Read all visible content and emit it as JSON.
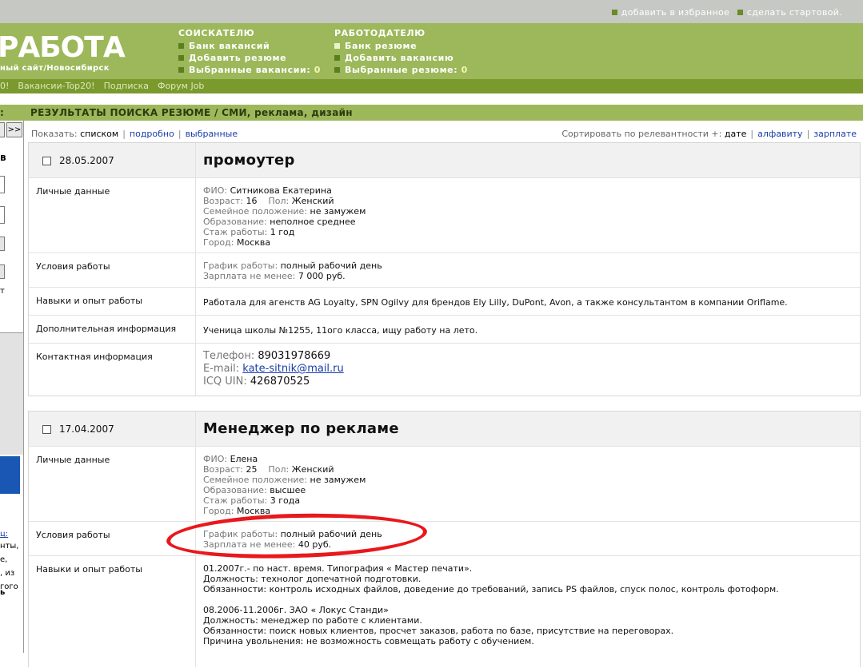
{
  "top_links": {
    "favorites": "добавить в избранное",
    "start_page": "сделать стартовой."
  },
  "logo": {
    "text": "РАБОТА",
    "tagline": "ный сайт/Новосибирск"
  },
  "applicant_menu": {
    "heading": "СОИСКАТЕЛЮ",
    "items": [
      "Банк вакансий",
      "Добавить резюме",
      "Выбранные вакансии:"
    ],
    "count": "0"
  },
  "employer_menu": {
    "heading": "РАБОТОДАТЕЛЮ",
    "items": [
      "Банк резюме",
      "Добавить вакансию",
      "Выбранные резюме:"
    ],
    "count": "0"
  },
  "nav": [
    "0!",
    "Вакансии-Top20!",
    "Подписка",
    "Форум Job"
  ],
  "title_bar": {
    "colon": ":",
    "text": "РЕЗУЛЬТАТЫ ПОИСКА РЕЗЮМЕ / СМИ, реклама, дизайн"
  },
  "sidebar": {
    "next_button": ">>",
    "fragments": [
      "в",
      "т",
      "ц:",
      "нты,",
      "е,",
      ", из",
      "гого",
      "ь"
    ]
  },
  "view_controls": {
    "label": "Показать:",
    "current": "списком",
    "options": [
      "подробно",
      "выбранные"
    ]
  },
  "sort_controls": {
    "label": "Сортировать по релевантности +:",
    "current": "дате",
    "options": [
      "алфавиту",
      "зарплате"
    ]
  },
  "labels": {
    "personal": "Личные данные",
    "conditions": "Условия работы",
    "skills": "Навыки и опыт работы",
    "additional": "Дополнительная информация",
    "contact": "Контактная информация",
    "fio": "ФИО:",
    "age": "Возраст:",
    "sex": "Пол:",
    "marital": "Семейное положение:",
    "education": "Образование:",
    "experience": "Стаж работы:",
    "city": "Город:",
    "schedule": "График работы:",
    "salary": "Зарплата не менее:",
    "phone": "Телефон:",
    "email": "E-mail:",
    "icq": "ICQ UIN:"
  },
  "resumes": [
    {
      "date": "28.05.2007",
      "title": "промоутер",
      "fio": "Ситникова Екатерина",
      "age": "16",
      "sex": "Женский",
      "marital": "не замужем",
      "education": "неполное среднее",
      "experience": "1 год",
      "city": "Москва",
      "schedule": "полный рабочий день",
      "salary": "7 000 руб.",
      "skills": "Работала для агенств AG Loyalty, SPN Ogilvy для брендов Ely Lilly, DuPont, Avon, а также консультантом в компании Oriflame.",
      "additional": "Ученица школы №1255, 11ого класса, ищу работу на лето.",
      "phone": "89031978669",
      "email": "kate-sitnik@mail.ru",
      "icq": "426870525"
    },
    {
      "date": "17.04.2007",
      "title": "Менеджер по рекламе",
      "fio": "Елена",
      "age": "25",
      "sex": "Женский",
      "marital": "не замужем",
      "education": "высшее",
      "experience": "3 года",
      "city": "Москва",
      "schedule": "полный рабочий день",
      "salary": "40 руб.",
      "skills_lines": [
        "01.2007г.- по наст. время. Типография « Мастер печати».",
        "Должность: технолог допечатной подготовки.",
        "Обязанности: контроль исходных файлов, доведение до требований, запись PS файлов, спуск полос, контроль фотоформ.",
        "",
        "08.2006-11.2006г. ЗАО « Локус Станди»",
        "Должность: менеджер по работе с клиентами.",
        "Обязанности: поиск новых клиентов, просчет заказов, работа по базе, присутствие на переговорах.",
        "Причина увольнения: не возможность совмещать работу с обучением."
      ]
    }
  ],
  "colors": {
    "header_green": "#9cb85a",
    "nav_green": "#7a9a2e",
    "link_blue": "#1a3caa",
    "annotation_red": "#e8181c"
  }
}
